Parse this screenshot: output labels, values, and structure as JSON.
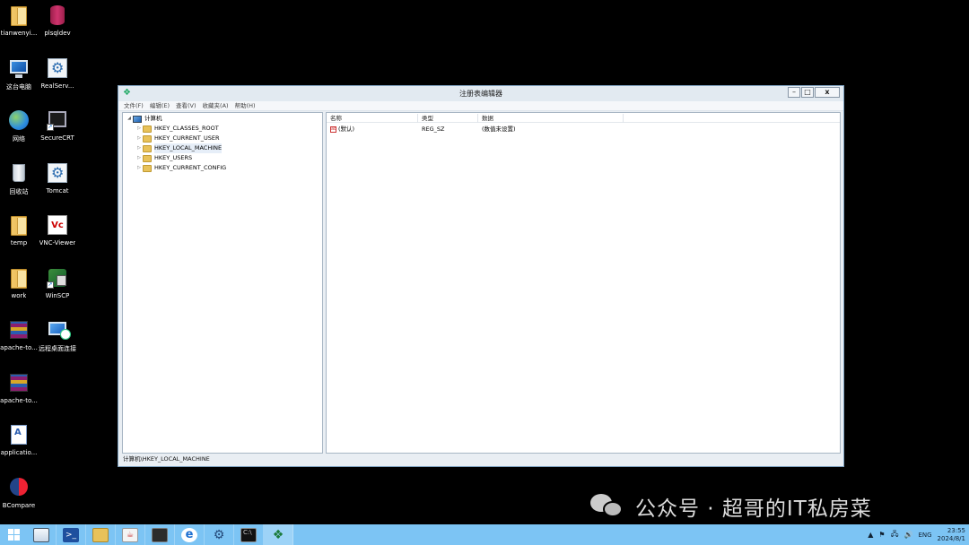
{
  "desktop": {
    "icons": [
      {
        "label": "tianwenyi...",
        "icon": "folder-icon"
      },
      {
        "label": "plsqldev",
        "icon": "plsqldev-icon"
      },
      {
        "label": "这台电脑",
        "icon": "computer-icon"
      },
      {
        "label": "RealServ...",
        "icon": "app-icon"
      },
      {
        "label": "网络",
        "icon": "network-icon"
      },
      {
        "label": "SecureCRT",
        "icon": "securecrt-icon"
      },
      {
        "label": "回收站",
        "icon": "recycle-bin-icon"
      },
      {
        "label": "Tomcat",
        "icon": "tomcat-icon"
      },
      {
        "label": "temp",
        "icon": "folder-icon"
      },
      {
        "label": "VNC-Viewer",
        "icon": "vnc-icon"
      },
      {
        "label": "work",
        "icon": "folder-icon"
      },
      {
        "label": "WinSCP",
        "icon": "winscp-icon"
      },
      {
        "label": "apache-to...",
        "icon": "winrar-icon"
      },
      {
        "label": "远程桌面连接",
        "icon": "remote-desktop-icon"
      },
      {
        "label": "apache-to...",
        "icon": "winrar-icon"
      },
      {
        "label": "applicatio...",
        "icon": "document-icon"
      },
      {
        "label": "BCompare",
        "icon": "bcompare-icon"
      }
    ]
  },
  "regedit": {
    "title": "注册表编辑器",
    "buttons": {
      "minimize": "–",
      "maximize": "□",
      "close": "x"
    },
    "menu": [
      "文件(F)",
      "编辑(E)",
      "查看(V)",
      "收藏夹(A)",
      "帮助(H)"
    ],
    "tree": {
      "root": "计算机",
      "root_expander": "◢",
      "child_expander": "▷",
      "children": [
        "HKEY_CLASSES_ROOT",
        "HKEY_CURRENT_USER",
        "HKEY_LOCAL_MACHINE",
        "HKEY_USERS",
        "HKEY_CURRENT_CONFIG"
      ],
      "selected": "HKEY_LOCAL_MACHINE"
    },
    "columns": {
      "name": "名称",
      "type": "类型",
      "data": "数据"
    },
    "values": [
      {
        "name": "(默认)",
        "type": "REG_SZ",
        "data": "(数值未设置)",
        "icon_text": "ab"
      }
    ],
    "status": "计算机\\HKEY_LOCAL_MACHINE"
  },
  "watermark": {
    "text": "公众号 · 超哥的IT私房菜"
  },
  "taskbar": {
    "tray_icons": [
      "▲",
      "⚑",
      "🖧",
      "🔊"
    ],
    "language": "ENG",
    "time": "23:55",
    "date": "2024/8/1"
  },
  "colors": {
    "taskbar": "#7cc4f4",
    "desktop": "#000000",
    "window_frame": "#7fa2c0"
  }
}
